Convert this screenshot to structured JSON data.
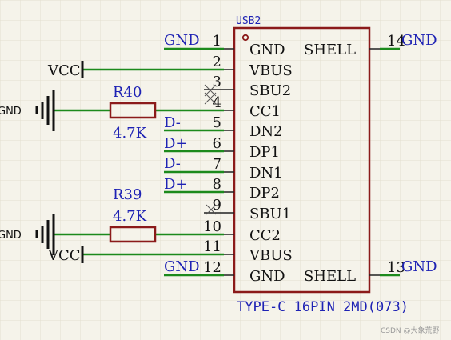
{
  "component": {
    "designator": "USB2",
    "value": "TYPE-C 16PIN 2MD(073)"
  },
  "pins": [
    {
      "num": "1",
      "name": "GND",
      "net": "GND",
      "side": "left"
    },
    {
      "num": "2",
      "name": "VBUS",
      "net": "VCC",
      "side": "left"
    },
    {
      "num": "3",
      "name": "SBU2",
      "net": "",
      "side": "left"
    },
    {
      "num": "4",
      "name": "CC1",
      "net": "",
      "side": "left"
    },
    {
      "num": "5",
      "name": "DN2",
      "net": "D-",
      "side": "left"
    },
    {
      "num": "6",
      "name": "DP1",
      "net": "D+",
      "side": "left"
    },
    {
      "num": "7",
      "name": "DN1",
      "net": "D-",
      "side": "left"
    },
    {
      "num": "8",
      "name": "DP2",
      "net": "D+",
      "side": "left"
    },
    {
      "num": "9",
      "name": "SBU1",
      "net": "",
      "side": "left"
    },
    {
      "num": "10",
      "name": "CC2",
      "net": "",
      "side": "left"
    },
    {
      "num": "11",
      "name": "VBUS",
      "net": "VCC",
      "side": "left"
    },
    {
      "num": "12",
      "name": "GND",
      "net": "GND",
      "side": "left"
    },
    {
      "num": "14",
      "name": "SHELL",
      "net": "GND",
      "side": "right"
    },
    {
      "num": "13",
      "name": "SHELL",
      "net": "GND",
      "side": "right"
    }
  ],
  "resistors": [
    {
      "ref": "R40",
      "value": "4.7K"
    },
    {
      "ref": "R39",
      "value": "4.7K"
    }
  ],
  "power_labels": {
    "vcc_top": "VCC",
    "vcc_bottom": "VCC",
    "gnd_left_top": "GND",
    "gnd_left_bottom": "GND"
  },
  "watermark": "CSDN @大象荒野",
  "colors": {
    "background": "#f5f3ea",
    "grid": "#e3dfd0",
    "body": "#8b1a1a",
    "wire": "#1c8a1c",
    "pin": "#222222",
    "net_label": "#1e22b4",
    "text": "#111111"
  }
}
